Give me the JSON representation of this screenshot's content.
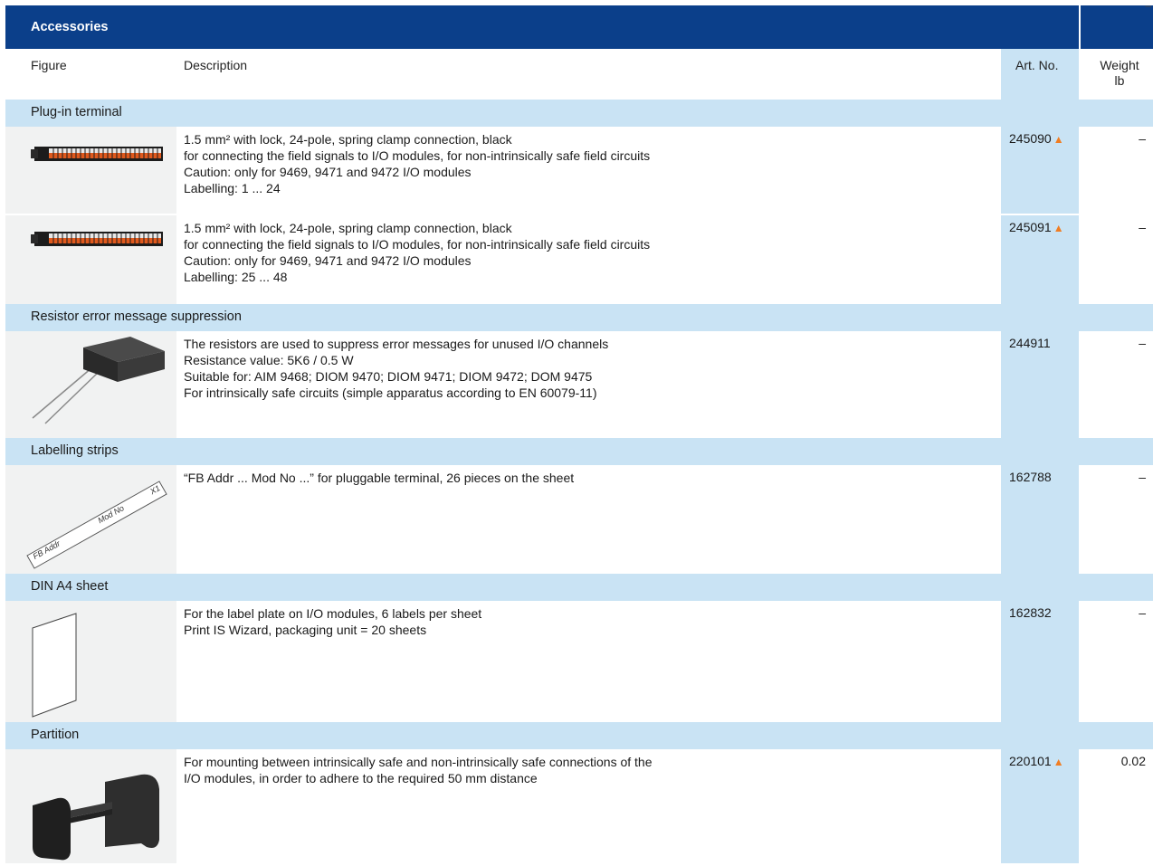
{
  "header": {
    "title": "Accessories",
    "corner_dash": "–"
  },
  "columns": {
    "figure": "Figure",
    "description": "Description",
    "art_no": "Art. No.",
    "weight": "Weight",
    "weight_unit": "lb"
  },
  "sections": [
    {
      "title": "Plug-in terminal"
    },
    {
      "title": "Resistor error message suppression"
    },
    {
      "title": "Labelling strips"
    },
    {
      "title": "DIN A4 sheet"
    },
    {
      "title": "Partition"
    }
  ],
  "rows": [
    {
      "description": "1.5 mm² with lock, 24-pole, spring clamp connection, black\nfor connecting the field signals to I/O modules, for non-intrinsically safe field circuits\nCaution: only for 9469, 9471 and 9472 I/O modules\nLabelling: 1 ... 24",
      "art_no": "245090",
      "marker": "▲",
      "weight": "–"
    },
    {
      "description": "1.5 mm² with lock, 24-pole, spring clamp connection, black\nfor connecting the field signals to I/O modules, for non-intrinsically safe field circuits\nCaution: only for 9469, 9471 and 9472 I/O modules\nLabelling: 25 ... 48",
      "art_no": "245091",
      "marker": "▲",
      "weight": "–"
    },
    {
      "description": "The resistors are used to suppress error messages for unused I/O channels\nResistance value: 5K6 / 0.5 W\nSuitable for: AIM 9468; DIOM 9470; DIOM 9471; DIOM 9472; DOM 9475\nFor intrinsically safe circuits (simple apparatus according to EN 60079-11)",
      "art_no": "244911",
      "marker": "",
      "weight": "–"
    },
    {
      "description": "“FB Addr ... Mod No ...” for pluggable terminal, 26 pieces on the sheet",
      "art_no": "162788",
      "marker": "",
      "weight": "–"
    },
    {
      "description": "For the label plate on I/O modules, 6 labels per sheet\nPrint IS Wizard, packaging unit = 20 sheets",
      "art_no": "162832",
      "marker": "",
      "weight": "–"
    },
    {
      "description": "For mounting between intrinsically safe and non-intrinsically safe connections of the\nI/O modules, in order to adhere to the required 50 mm distance",
      "art_no": "220101",
      "marker": "▲",
      "weight": "0.02"
    }
  ],
  "strip_labels": {
    "fb": "FB Addr",
    "mod": "Mod No",
    "x1": "X1"
  },
  "colors": {
    "header": "#0b3f8a",
    "section": "#c9e3f4",
    "marker": "#f07d22"
  }
}
